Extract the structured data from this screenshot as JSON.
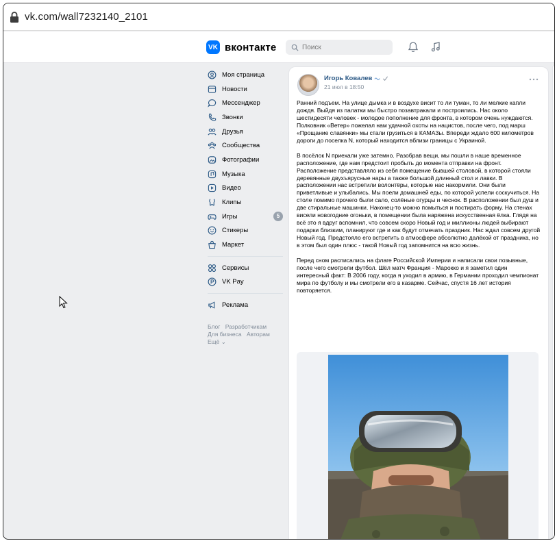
{
  "browser": {
    "url": "vk.com/wall7232140_2101"
  },
  "header": {
    "logo_mark": "VK",
    "logo_text": "вконтакте",
    "search_placeholder": "Поиск"
  },
  "sidebar": {
    "items": [
      {
        "label": "Моя страница",
        "icon": "user-circle-icon"
      },
      {
        "label": "Новости",
        "icon": "news-icon"
      },
      {
        "label": "Мессенджер",
        "icon": "message-icon"
      },
      {
        "label": "Звонки",
        "icon": "phone-icon"
      },
      {
        "label": "Друзья",
        "icon": "friends-icon"
      },
      {
        "label": "Сообщества",
        "icon": "communities-icon"
      },
      {
        "label": "Фотографии",
        "icon": "photo-icon"
      },
      {
        "label": "Музыка",
        "icon": "music-icon"
      },
      {
        "label": "Видео",
        "icon": "video-icon"
      },
      {
        "label": "Клипы",
        "icon": "clips-icon"
      },
      {
        "label": "Игры",
        "icon": "gamepad-icon",
        "badge": "5"
      },
      {
        "label": "Стикеры",
        "icon": "sticker-icon"
      },
      {
        "label": "Маркет",
        "icon": "market-icon"
      }
    ],
    "items2": [
      {
        "label": "Сервисы",
        "icon": "services-icon"
      },
      {
        "label": "VK Pay",
        "icon": "vkpay-icon"
      }
    ],
    "items3": [
      {
        "label": "Реклама",
        "icon": "ads-icon"
      }
    ],
    "footer": {
      "blog": "Блог",
      "developers": "Разработчикам",
      "business": "Для бизнеса",
      "authors": "Авторам",
      "more": "Ещё ⌄"
    }
  },
  "post": {
    "author": "Игорь Ковалев",
    "date": "21 июл в 18:50",
    "paragraphs": [
      "Ранний подъем. На улице дымка и в воздухе висит то ли туман, то ли мелкие капли дождя. Выйдя из палатки мы быстро позавтракали и построились. Нас около шестидесяти человек - молодое пополнение для фронта, в котором очень нуждаются. Полковник «Ветер» пожелал нам удачной охоты на нацистов, после чего, под марш «Прощание славянки» мы стали грузиться в КАМАЗы. Впереди ждало 600 километров дороги до поселка N, который находится вблизи границы с Украиной.",
      "В посёлок N приехали уже затемно. Разобрав вещи, мы пошли в наше временное расположение, где нам предстоит пробыть до момента отправки на фронт. Расположение представляло из себя помещение бывшей столовой, в которой стояли деревянные двухъярусные нары а также большой длинный стол и лавки. В расположении нас встретили волонтёры, которые нас накормили. Они были приветливые и улыбались. Мы поели домашней еды, по которой успели соскучиться. На столе помимо прочего были сало, солёные огурцы и чеснок. В расположении был душ и две стиральные машинки. Наконец-то можно помыться и постирать форму. На стенах висели новогодние огоньки, в помещении была наряжена искусственная ёлка. Глядя на всё это я вдруг вспомнил, что совсем скоро Новый год и миллионы людей выбирают подарки близким, планируют где и как будут отмечать праздник. Нас ждал совсем другой Новый год. Предстояло его встретить в атмосфере абсолютно далёкой от праздника, но в этом был один плюс - такой Новый год запомнится на всю жизнь.",
      "Перед сном расписались на флаге Российской Империи и написали свои позывные, после чего смотрели футбол. Шёл матч Франция - Марокко и я заметил один интересный факт: В 2006 году, когда я уходил в армию, в Германии проходил чемпионат мира по футболу и мы смотрели его в казарме. Сейчас, спустя 16 лет история повторяется."
    ]
  }
}
